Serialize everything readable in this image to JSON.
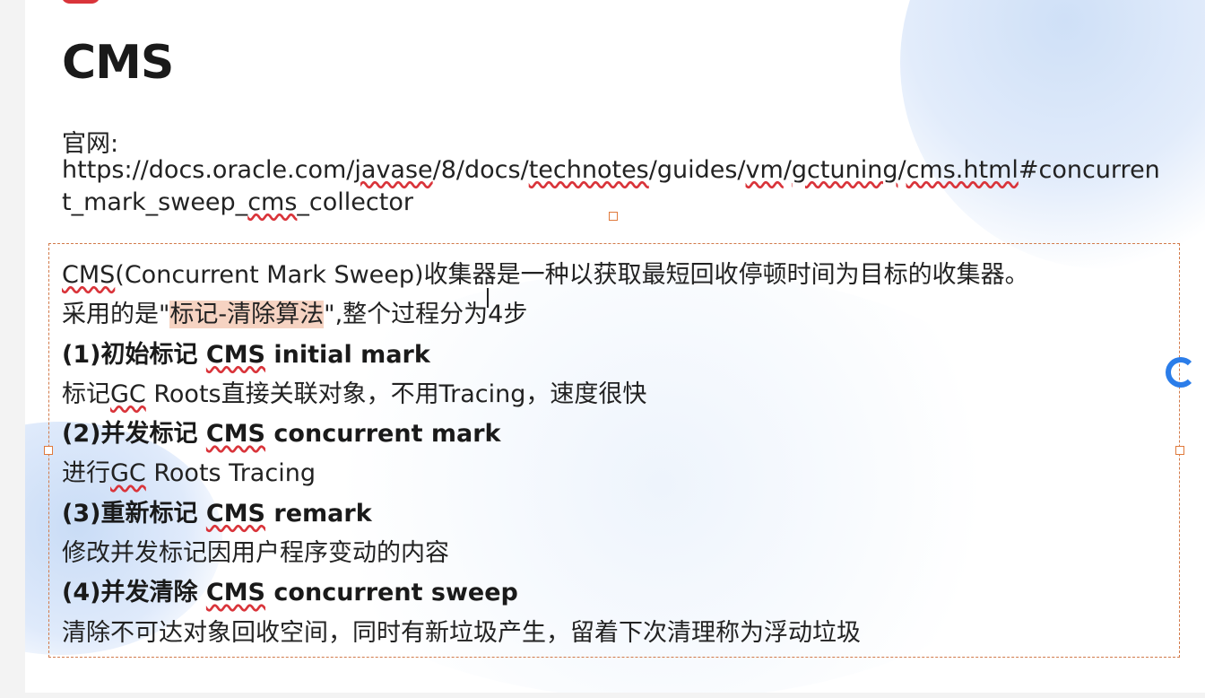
{
  "slide": {
    "title": "CMS",
    "site_label": "官网:",
    "url_parts": {
      "p1": "https://docs.oracle.com/",
      "p2": "javase",
      "p3": "/8/docs/",
      "p4": "technotes",
      "p5": "/guides/",
      "p6": "vm",
      "p7": "/",
      "p8": "gctuning",
      "p9": "/",
      "p10": "cms.html",
      "p11": "#concurrent_mark_sweep_",
      "p12": "cms",
      "p13": "_collector"
    },
    "intro": {
      "cms": "CMS",
      "rest": "(Concurrent Mark Sweep)收集器是一种以获取最短回收停顿时间为目标的收集器。"
    },
    "algorithm": {
      "prefix": "采用的是\"",
      "highlight": "标记-清除算法",
      "suffix": "\",整个过程分为4步"
    },
    "steps": [
      {
        "head_prefix": "(1)初始标记 ",
        "head_cms": "CMS",
        "head_suffix": " initial mark",
        "desc_prefix": "标记",
        "desc_gc": "GC",
        "desc_suffix": " Roots直接关联对象，不用Tracing，速度很快"
      },
      {
        "head_prefix": "(2)并发标记 ",
        "head_cms": "CMS",
        "head_suffix": " concurrent mark",
        "desc_prefix": "进行",
        "desc_gc": "GC",
        "desc_suffix": " Roots Tracing"
      },
      {
        "head_prefix": "(3)重新标记 ",
        "head_cms": "CMS",
        "head_suffix": " remark",
        "desc": "修改并发标记因用户程序变动的内容"
      },
      {
        "head_prefix": "(4)并发清除 ",
        "head_cms": "CMS",
        "head_suffix": " concurrent sweep",
        "desc": "清除不可达对象回收空间，同时有新垃圾产生，留着下次清理称为浮动垃圾"
      }
    ]
  },
  "colors": {
    "title": "#1a1a1a",
    "text": "#222222",
    "highlight": "#f6d3c2",
    "selection_border": "#d27a4a",
    "spell_underline": "#d9343a",
    "spinner": "#2b7de9"
  },
  "icons": [
    "loading-spinner-icon",
    "text-cursor-icon"
  ]
}
